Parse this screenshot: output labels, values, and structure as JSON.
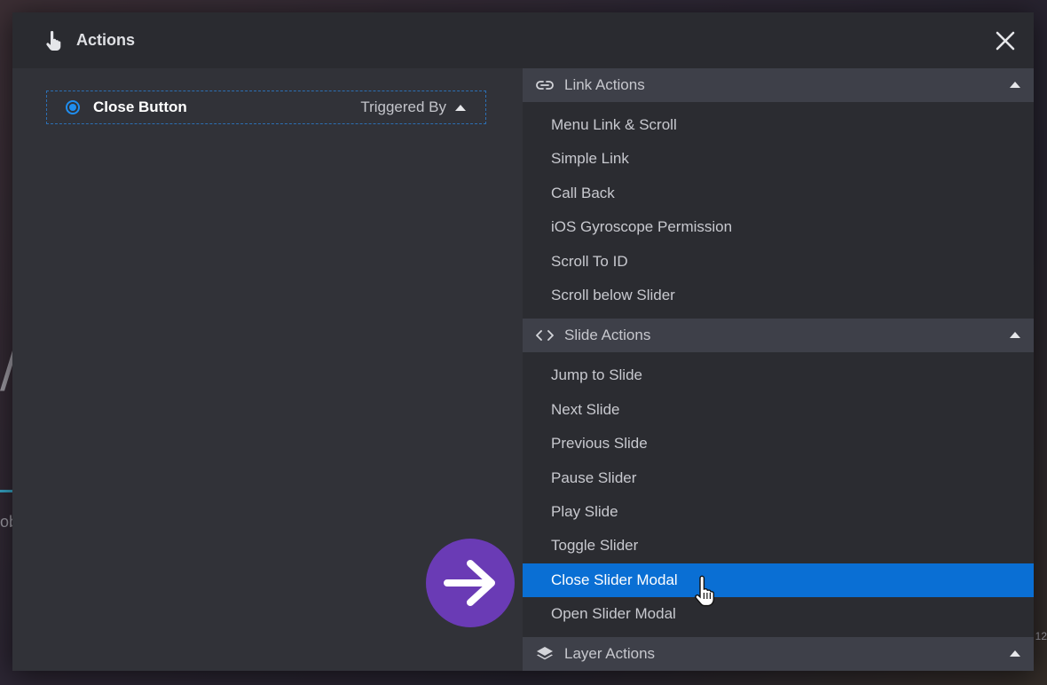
{
  "modal": {
    "title": "Actions",
    "icon": "hand-pointer-icon",
    "close_icon": "close-icon"
  },
  "trigger": {
    "name": "Close Button",
    "triggered_by_label": "Triggered By"
  },
  "groups": [
    {
      "title": "Link Actions",
      "icon": "link-icon",
      "items": [
        "Menu Link & Scroll",
        "Simple Link",
        "Call Back",
        "iOS Gyroscope Permission",
        "Scroll To ID",
        "Scroll below Slider"
      ]
    },
    {
      "title": "Slide Actions",
      "icon": "code-icon",
      "items": [
        "Jump to Slide",
        "Next Slide",
        "Previous Slide",
        "Pause Slider",
        "Play Slide",
        "Toggle Slider",
        "Close Slider Modal",
        "Open Slider Modal"
      ],
      "selected_item": "Close Slider Modal"
    },
    {
      "title": "Layer Actions",
      "icon": "layers-icon",
      "items": []
    }
  ],
  "background": {
    "fragment_a": "/",
    "fragment_b": "ob",
    "fragment_c": "12"
  },
  "colors": {
    "accent": "#0a6fd4",
    "badge": "#6a3bb5",
    "modal_bg": "#313238",
    "group_header_bg": "#3e4049"
  }
}
